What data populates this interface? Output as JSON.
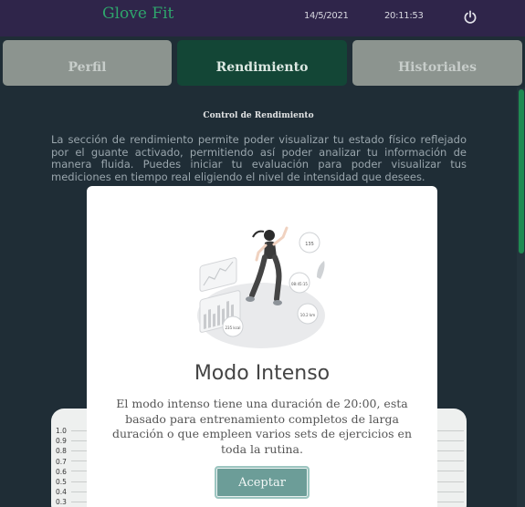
{
  "header": {
    "app_title": "Glove Fit",
    "date": "14/5/2021",
    "time": "20:11:53",
    "power_icon": "power-icon"
  },
  "tabs": [
    {
      "label": "Perfil"
    },
    {
      "label": "Rendimiento"
    },
    {
      "label": "Historiales"
    }
  ],
  "section": {
    "title": "Control de Rendimiento",
    "text": "La sección de rendimiento permite poder visualizar tu estado físico reflejado por el guante activado, permitiendo así poder analizar tu información de manera fluida. Puedes iniciar tu evaluación para poder visualizar tus mediciones en tiempo real eligiendo el nivel de intensidad que desees."
  },
  "chart": {
    "y_ticks": [
      "1.0",
      "0.9",
      "0.8",
      "0.7",
      "0.6",
      "0.5",
      "0.4",
      "0.3"
    ]
  },
  "modal": {
    "title": "Modo Intenso",
    "text": "El modo intenso tiene una duración de 20:00, esta basado para entrenamiento completos de larga duración o que empleen varios sets de ejercicios en toda la rutina.",
    "button": "Aceptar",
    "illustration": {
      "label_1": "135",
      "label_2": "08:45:15",
      "label_3": "10.2 km",
      "label_4": "235 kcal"
    }
  },
  "colors": {
    "topbar": "#2f254a",
    "brand": "#2fa56c",
    "active_tab": "#134636",
    "inactive_tab": "#8c948f",
    "background": "#1f2d36",
    "button": "#6c9d98"
  }
}
